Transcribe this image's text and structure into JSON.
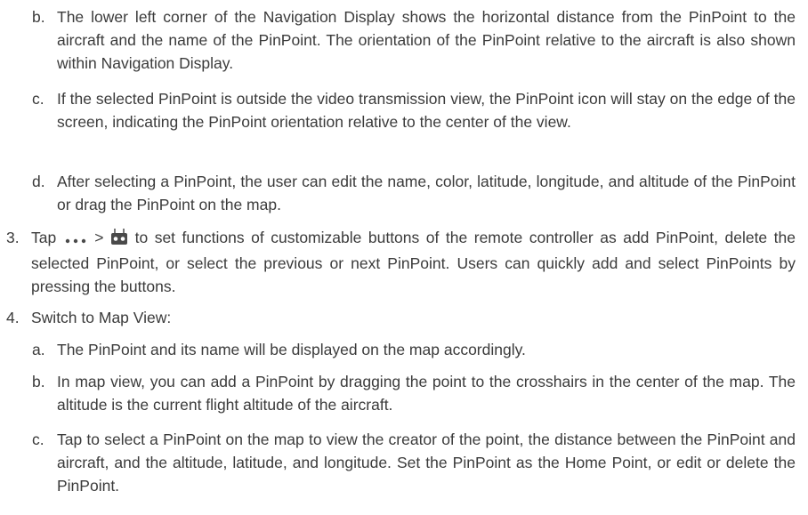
{
  "section_b": {
    "marker": "b.",
    "text": "The lower left corner of the Navigation Display shows the horizontal distance from the PinPoint to the aircraft and the name of the PinPoint. The orientation of the PinPoint relative to the aircraft is also shown within Navigation Display."
  },
  "section_c": {
    "marker": "c.",
    "text": "If the selected PinPoint is outside the video transmission view, the PinPoint icon will stay on the edge of the screen, indicating the PinPoint orientation relative to the center of the view."
  },
  "section_d": {
    "marker": "d.",
    "text": "After selecting a PinPoint, the user can edit the name, color, latitude, longitude, and altitude of the PinPoint or drag the PinPoint on the map."
  },
  "step3": {
    "marker": "3.",
    "prefix": "Tap",
    "sep": ">",
    "text": "to set functions of customizable buttons of the remote controller as add PinPoint, delete the selected PinPoint, or select the previous or next PinPoint. Users can quickly add and select PinPoints by pressing the buttons.",
    "icons": [
      "more-dots-icon",
      "remote-controller-icon"
    ]
  },
  "step4": {
    "marker": "4.",
    "text": "Switch to Map View:",
    "items": [
      {
        "marker": "a.",
        "text": "The PinPoint and its name will be displayed on the map accordingly."
      },
      {
        "marker": "b.",
        "text": "In map view, you can add a PinPoint by dragging the point to the crosshairs in the center of the map. The altitude is the current flight altitude of the aircraft."
      },
      {
        "marker": "c.",
        "text": "Tap to select a PinPoint on the map to view the creator of the point, the distance between the PinPoint and aircraft, and the altitude, latitude, and longitude. Set the PinPoint as the Home Point, or edit or delete the PinPoint."
      }
    ]
  }
}
